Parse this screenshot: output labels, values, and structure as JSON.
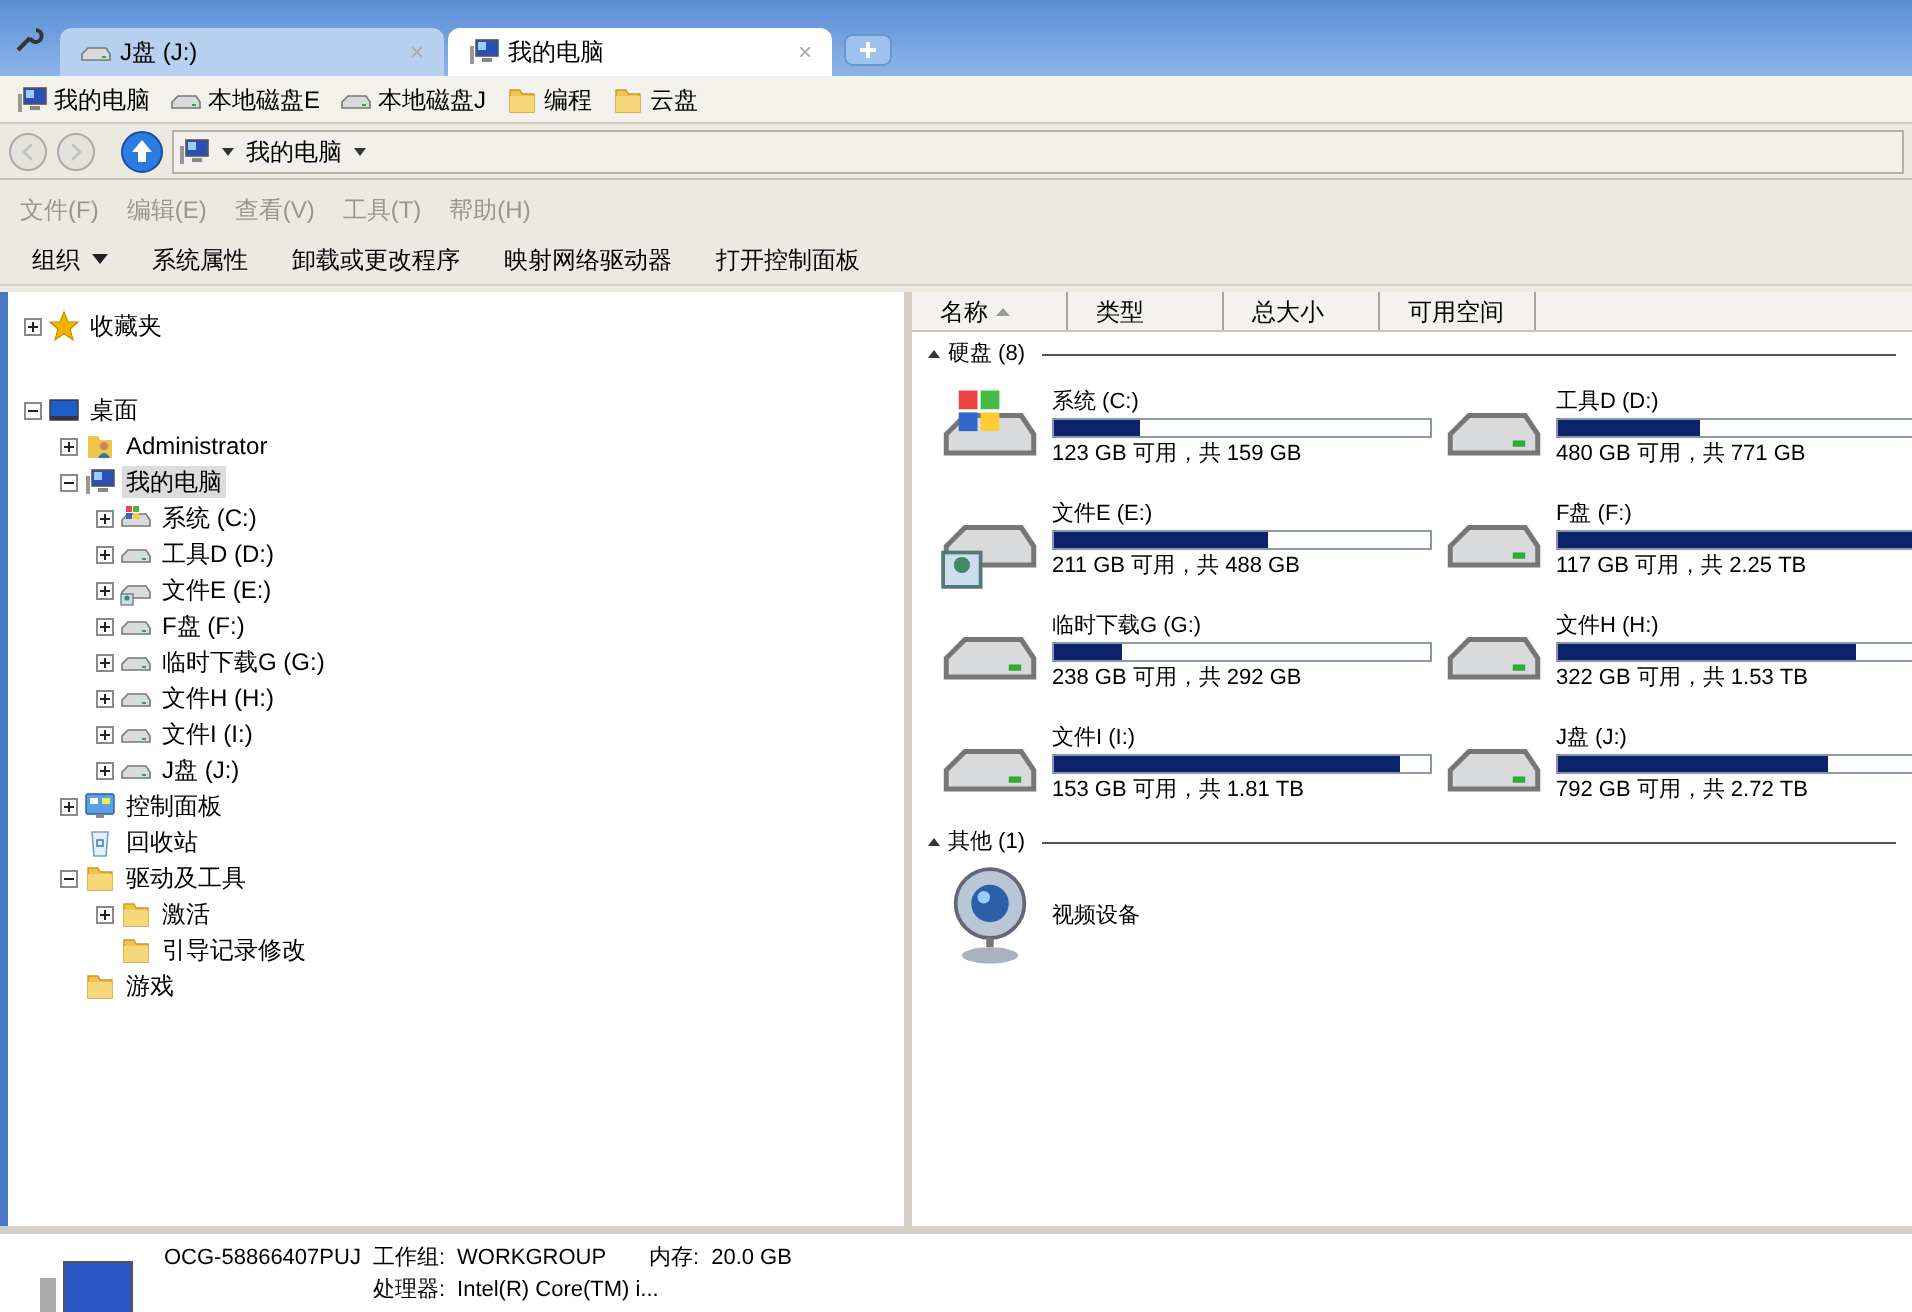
{
  "tabs": [
    {
      "label": "J盘 (J:)",
      "kind": "drive",
      "selected": false,
      "close": "×"
    },
    {
      "label": "我的电脑",
      "kind": "computer",
      "selected": true,
      "close": "×"
    }
  ],
  "bookmarks": [
    {
      "label": "我的电脑",
      "kind": "computer"
    },
    {
      "label": "本地磁盘E",
      "kind": "drive"
    },
    {
      "label": "本地磁盘J",
      "kind": "drive"
    },
    {
      "label": "编程",
      "kind": "folder"
    },
    {
      "label": "云盘",
      "kind": "folder"
    }
  ],
  "address": {
    "crumb": "我的电脑"
  },
  "menu": [
    {
      "label": "文件(F)",
      "disabled": true
    },
    {
      "label": "编辑(E)",
      "disabled": true
    },
    {
      "label": "查看(V)",
      "disabled": true
    },
    {
      "label": "工具(T)",
      "disabled": true
    },
    {
      "label": "帮助(H)",
      "disabled": true
    }
  ],
  "toolbar": [
    {
      "label": "组织",
      "dropdown": true
    },
    {
      "label": "系统属性",
      "dropdown": false
    },
    {
      "label": "卸载或更改程序",
      "dropdown": false
    },
    {
      "label": "映射网络驱动器",
      "dropdown": false
    },
    {
      "label": "打开控制面板",
      "dropdown": false
    }
  ],
  "tree": [
    {
      "label": "收藏夹",
      "kind": "favorites",
      "expanded": false,
      "selected": false
    },
    {
      "label": "桌面",
      "kind": "desktop",
      "expanded": true,
      "selected": false,
      "children": [
        {
          "label": "Administrator",
          "kind": "user",
          "expanded": false,
          "selected": false
        },
        {
          "label": "我的电脑",
          "kind": "computer",
          "expanded": true,
          "selected": true,
          "children": [
            {
              "label": "系统 (C:)",
              "kind": "system-drive",
              "expanded": false,
              "selected": false
            },
            {
              "label": "工具D (D:)",
              "kind": "drive",
              "expanded": false,
              "selected": false
            },
            {
              "label": "文件E (E:)",
              "kind": "shared-drive",
              "expanded": false,
              "selected": false
            },
            {
              "label": "F盘 (F:)",
              "kind": "drive",
              "expanded": false,
              "selected": false
            },
            {
              "label": "临时下载G (G:)",
              "kind": "drive",
              "expanded": false,
              "selected": false
            },
            {
              "label": "文件H (H:)",
              "kind": "drive",
              "expanded": false,
              "selected": false
            },
            {
              "label": "文件I (I:)",
              "kind": "drive",
              "expanded": false,
              "selected": false
            },
            {
              "label": "J盘 (J:)",
              "kind": "drive",
              "expanded": false,
              "selected": false
            }
          ]
        },
        {
          "label": "控制面板",
          "kind": "control-panel",
          "expanded": false,
          "selected": false
        },
        {
          "label": "回收站",
          "kind": "recycle-bin",
          "selected": false
        },
        {
          "label": "驱动及工具",
          "kind": "folder",
          "expanded": true,
          "selected": false,
          "children": [
            {
              "label": "激活",
              "kind": "folder",
              "expanded": false,
              "selected": false
            },
            {
              "label": "引导记录修改",
              "kind": "folder",
              "selected": false
            }
          ]
        },
        {
          "label": "游戏",
          "kind": "folder",
          "selected": false
        }
      ]
    }
  ],
  "columns": [
    {
      "label": "名称",
      "sorted": true
    },
    {
      "label": "类型",
      "sorted": false
    },
    {
      "label": "总大小",
      "sorted": false
    },
    {
      "label": "可用空间",
      "sorted": false
    }
  ],
  "groups": [
    {
      "label": "硬盘 (8)",
      "expanded": true,
      "items": [
        {
          "name": "系统 (C:)",
          "kind": "system-drive",
          "level": 0.23,
          "info": "123 GB 可用，共 159 GB"
        },
        {
          "name": "工具D (D:)",
          "kind": "drive",
          "level": 0.38,
          "info": "480 GB 可用，共 771 GB"
        },
        {
          "name": "文件E (E:)",
          "kind": "shared-drive",
          "level": 0.57,
          "info": "211 GB 可用，共 488 GB"
        },
        {
          "name": "F盘 (F:)",
          "kind": "drive",
          "level": 0.95,
          "info": "117 GB 可用，共 2.25 TB"
        },
        {
          "name": "临时下载G (G:)",
          "kind": "drive",
          "level": 0.18,
          "info": "238 GB 可用，共 292 GB"
        },
        {
          "name": "文件H (H:)",
          "kind": "drive",
          "level": 0.79,
          "info": "322 GB 可用，共 1.53 TB"
        },
        {
          "name": "文件I (I:)",
          "kind": "drive",
          "level": 0.92,
          "info": "153 GB 可用，共 1.81 TB"
        },
        {
          "name": "J盘 (J:)",
          "kind": "drive",
          "level": 0.72,
          "info": "792 GB 可用，共 2.72 TB"
        }
      ]
    },
    {
      "label": "其他 (1)",
      "expanded": true,
      "items": [
        {
          "name": "视频设备",
          "kind": "webcam"
        }
      ]
    }
  ],
  "details": {
    "computer_name": "OCG-58866407PUJ",
    "workgroup_label": "工作组:",
    "workgroup": "WORKGROUP",
    "memory_label": "内存:",
    "memory": "20.0 GB",
    "cpu_label": "处理器:",
    "cpu": "Intel(R) Core(TM) i..."
  }
}
